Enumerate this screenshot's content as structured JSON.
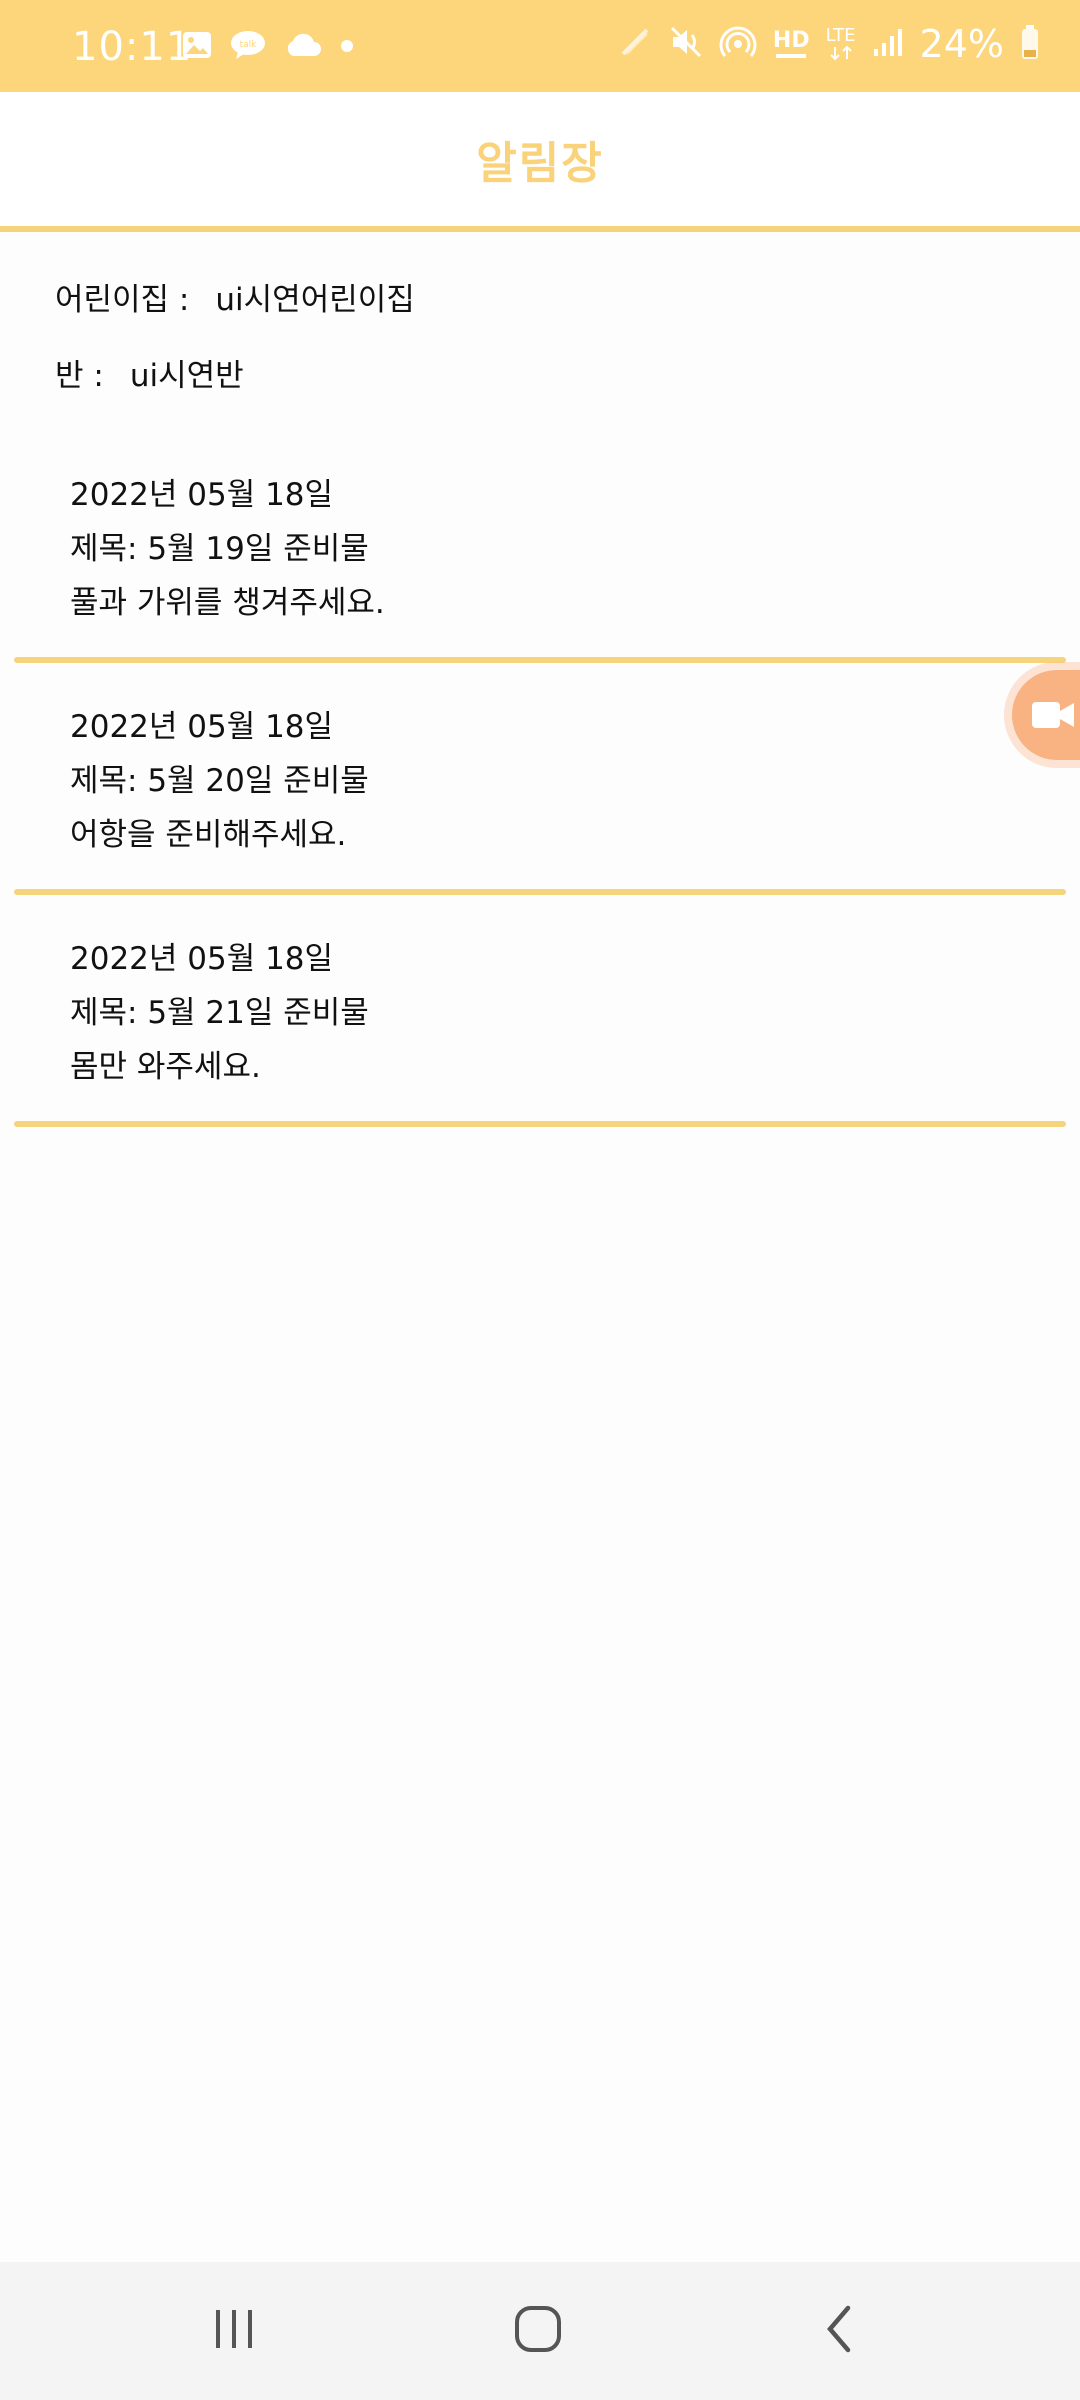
{
  "status_bar": {
    "time": "10:11",
    "battery": "24%",
    "left_icons": [
      "gallery-icon",
      "chat-icon",
      "cloud-icon",
      "dot-icon"
    ],
    "right_icons": [
      "nfc-icon",
      "mute-icon",
      "hotspot-icon",
      "hd-voice-icon",
      "lte-icon",
      "signal-icon",
      "battery-icon"
    ],
    "hd_label": "HD",
    "lte_label": "LTE"
  },
  "app": {
    "title": "알림장",
    "accent_color": "#f6d47c"
  },
  "info": {
    "daycare_label": "어린이집 :",
    "daycare_value": "ui시연어린이집",
    "class_label": "반 :",
    "class_value": "ui시연반"
  },
  "notices": [
    {
      "date": "2022년 05월 18일",
      "title": "제목: 5월 19일 준비물",
      "body": "풀과 가위를 챙겨주세요."
    },
    {
      "date": "2022년 05월 18일",
      "title": "제목: 5월 20일 준비물",
      "body": "어항을 준비해주세요."
    },
    {
      "date": "2022년 05월 18일",
      "title": "제목: 5월 21일 준비물",
      "body": "몸만 와주세요."
    }
  ],
  "floating_button": {
    "icon": "video-camera-icon"
  },
  "nav_bar": {
    "icons": [
      "recent-apps-icon",
      "home-icon",
      "back-icon"
    ]
  }
}
